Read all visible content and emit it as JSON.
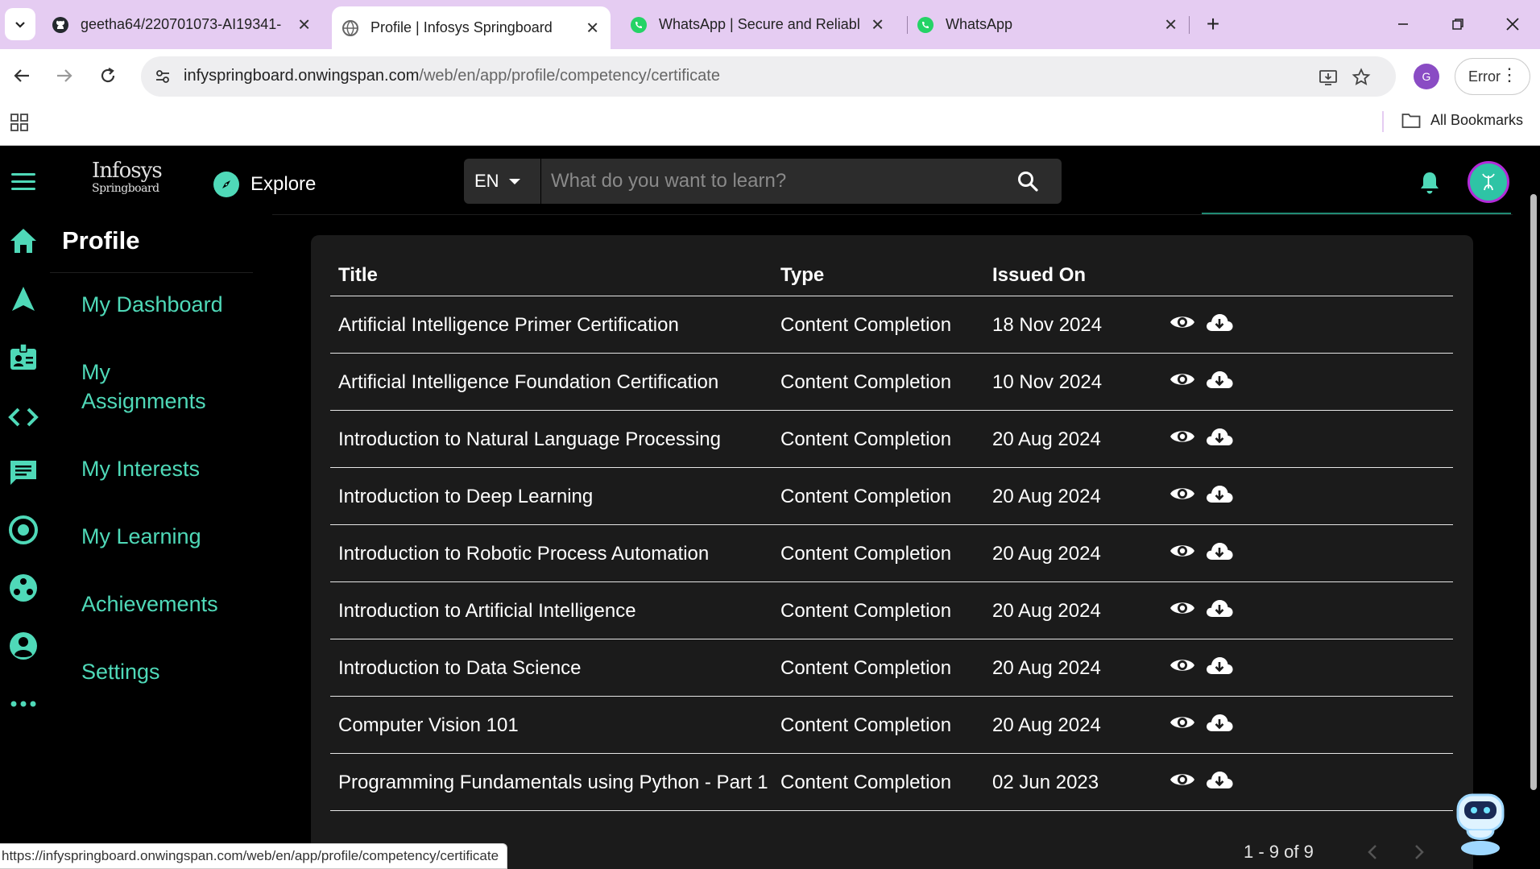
{
  "browser": {
    "tabs": [
      {
        "title": "geetha64/220701073-AI19341-",
        "icon": "github-icon",
        "active": false
      },
      {
        "title": "Profile | Infosys Springboard",
        "icon": "globe-icon",
        "active": true
      },
      {
        "title": "WhatsApp | Secure and Reliable",
        "icon": "whatsapp-icon",
        "active": false
      },
      {
        "title": "WhatsApp",
        "icon": "whatsapp-icon",
        "active": false
      }
    ],
    "url_host": "infyspringboard.onwingspan.com",
    "url_path": "/web/en/app/profile/competency/certificate",
    "profile_initial": "G",
    "error_label": "Error",
    "all_bookmarks_label": "All Bookmarks",
    "status_url": "https://infyspringboard.onwingspan.com/web/en/app/profile/competency/certificate",
    "colors": {
      "tabbar": "#e5ccf2",
      "profile": "#8a4cc4"
    }
  },
  "header": {
    "logo_line1": "Infosys",
    "logo_line2": "Springboard",
    "explore_label": "Explore",
    "language": "EN",
    "search_placeholder": "What do you want to learn?"
  },
  "rail_icons": [
    "home-icon",
    "navigate-icon",
    "badge-icon",
    "code-icon",
    "chat-icon",
    "target-icon",
    "community-icon",
    "account-icon",
    "more-icon"
  ],
  "profile_nav": {
    "title": "Profile",
    "items": [
      "My Dashboard",
      "My Assignments",
      "My Interests",
      "My Learning",
      "Achievements",
      "Settings"
    ]
  },
  "table": {
    "columns": [
      "Title",
      "Type",
      "Issued On"
    ],
    "rows": [
      {
        "title": "Artificial Intelligence Primer Certification",
        "type": "Content Completion",
        "issued": "18 Nov 2024"
      },
      {
        "title": "Artificial Intelligence Foundation Certification",
        "type": "Content Completion",
        "issued": "10 Nov 2024"
      },
      {
        "title": "Introduction to Natural Language Processing",
        "type": "Content Completion",
        "issued": "20 Aug 2024"
      },
      {
        "title": "Introduction to Deep Learning",
        "type": "Content Completion",
        "issued": "20 Aug 2024"
      },
      {
        "title": "Introduction to Robotic Process Automation",
        "type": "Content Completion",
        "issued": "20 Aug 2024"
      },
      {
        "title": "Introduction to Artificial Intelligence",
        "type": "Content Completion",
        "issued": "20 Aug 2024"
      },
      {
        "title": "Introduction to Data Science",
        "type": "Content Completion",
        "issued": "20 Aug 2024"
      },
      {
        "title": "Computer Vision 101",
        "type": "Content Completion",
        "issued": "20 Aug 2024"
      },
      {
        "title": "Programming Fundamentals using Python - Part 1",
        "type": "Content Completion",
        "issued": "02 Jun 2023"
      }
    ],
    "pagination": "1 - 9 of 9"
  },
  "theme": {
    "accent": "#4fd9b8",
    "background": "#000000",
    "card": "#1b1b1b",
    "avatar_ring": "#b42bd9"
  }
}
